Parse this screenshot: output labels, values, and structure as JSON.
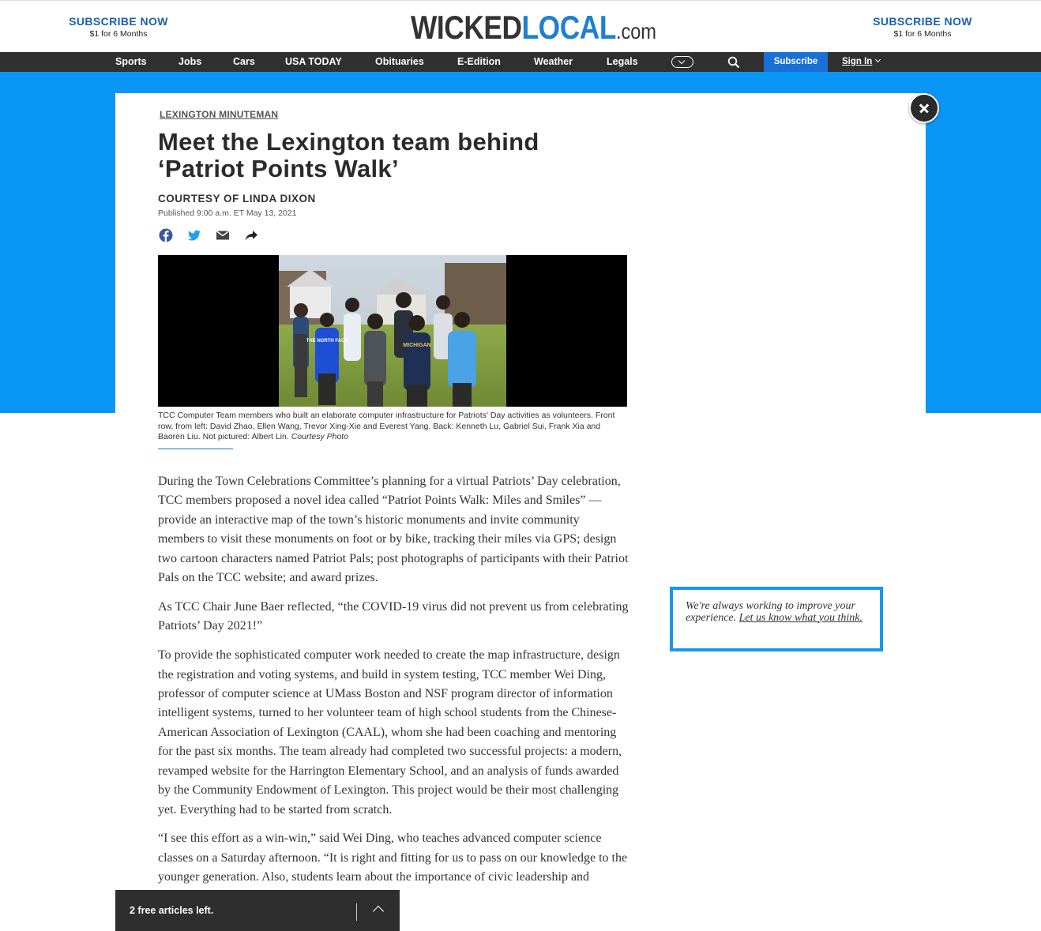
{
  "header": {
    "subscribe_left": {
      "title": "SUBSCRIBE NOW",
      "sub": "$1 for 6 Months"
    },
    "subscribe_right": {
      "title": "SUBSCRIBE NOW",
      "sub": "$1 for 6 Months"
    },
    "logo": {
      "part1": "WICKED",
      "part2": "LOCAL",
      "part3": ".com"
    }
  },
  "nav": {
    "items": [
      "Sports",
      "Jobs",
      "Cars",
      "USA TODAY",
      "Obituaries",
      "E-Edition",
      "Weather",
      "Legals"
    ],
    "subscribe": "Subscribe",
    "signin": "Sign In"
  },
  "article": {
    "section": "LEXINGTON MINUTEMAN",
    "headline_line1": "Meet the Lexington team behind",
    "headline_line2": "‘Patriot Points Walk’",
    "byline": "COURTESY OF LINDA DIXON",
    "published": "Published 9:00 a.m. ET May 13, 2021",
    "caption": "TCC Computer Team members who built an elaborate computer infrastructure for Patriots' Day activities as volunteers. Front row, from left: David Zhao, Ellen Wang, Trevor Xing-Xie and Everest Yang. Back: Kenneth Lu, Gabriel Sui, Frank Xia and Baoren Liu. Not pictured: Albert Lin.",
    "caption_credit": "Courtesy Photo",
    "paragraphs": [
      "During the Town Celebrations Committee’s planning for a virtual Patriots’ Day celebration, TCC members proposed a novel idea called “Patriot Points Walk: Miles and Smiles” — provide an interactive map of the town’s historic monuments and invite community members to visit these monuments on foot or by bike, tracking their miles via GPS; design two cartoon characters named Patriot Pals; post photographs of participants with their Patriot Pals on the TCC website; and award prizes.",
      "As TCC Chair June Baer reflected, “the COVID-19 virus did not prevent us from celebrating Patriots’ Day 2021!”",
      "To provide the sophisticated computer work needed to create the map infrastructure, design the registration and voting systems, and build in system testing, TCC member Wei Ding, professor of computer science at UMass Boston and NSF program director of information intelligent systems, turned to her volunteer team of high school students from the Chinese-American Association of Lexington (CAAL), whom she had been coaching and mentoring for the past six months. The team already had completed two successful projects: a modern, revamped website for the Harrington Elementary School, and an analysis of funds awarded by the Community Endowment of Lexington. This project would be their most challenging yet. Everything had to be started from scratch.",
      "“I see this effort as a win-win,” said Wei Ding, who teaches advanced computer science classes on a Saturday afternoon. “It is right and fitting for us to pass on our knowledge to the younger generation. Also, students learn about the importance of civic leadership and"
    ]
  },
  "photo": {
    "shirt_texts": [
      "THE NORTH FACE",
      "MICHIGAN"
    ]
  },
  "feedback": {
    "text": "We're always working to improve your experience.",
    "link": "Let us know what you think."
  },
  "meter": {
    "text": "2 free articles left."
  },
  "colors": {
    "accent_blue": "#0a96f4",
    "link_blue": "#1a5fb4",
    "nav_bg": "#303030"
  }
}
